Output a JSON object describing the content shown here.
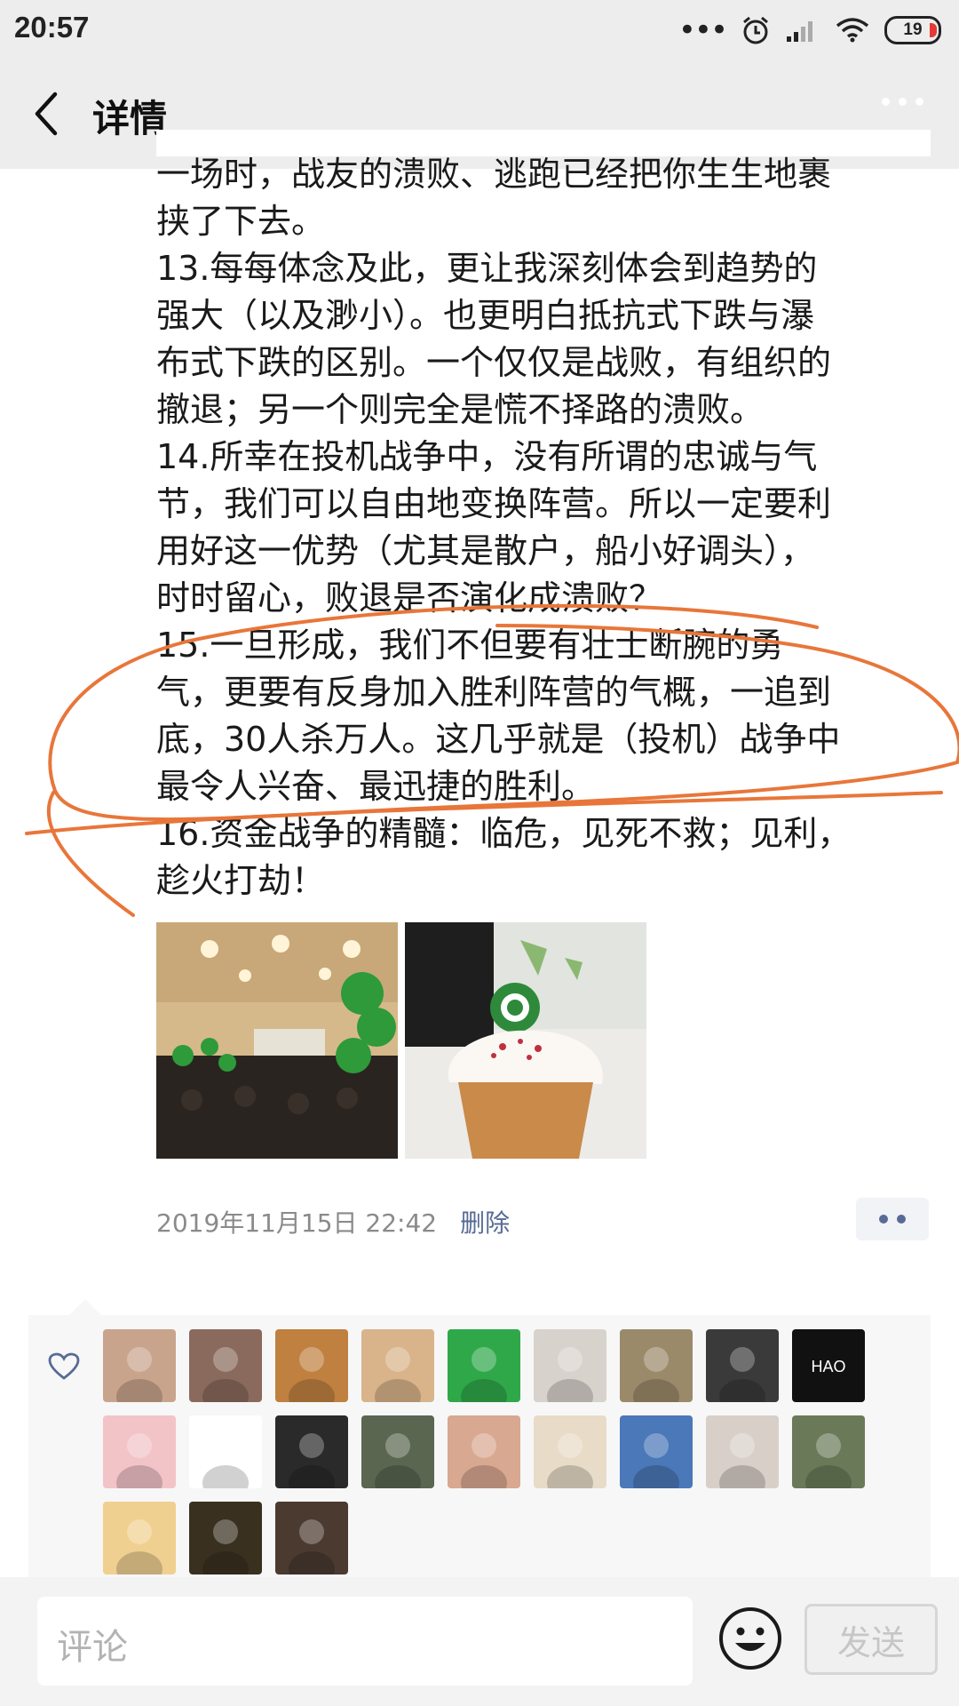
{
  "status_bar": {
    "time": "20:57",
    "battery": "19"
  },
  "nav": {
    "title": "详情"
  },
  "post": {
    "lines": [
      "一场时，战友的溃败、逃跑已经把你生生地裹",
      "挟了下去。",
      "13.每每体念及此，更让我深刻体会到趋势的",
      "强大（以及渺小）。也更明白抵抗式下跌与瀑",
      "布式下跌的区别。一个仅仅是战败，有组织的",
      "撤退；另一个则完全是慌不择路的溃败。",
      "14.所幸在投机战争中，没有所谓的忠诚与气",
      "节，我们可以自由地变换阵营。所以一定要利",
      "用好这一优势（尤其是散户，船小好调头），",
      "时时留心，败退是否演化成溃败？",
      "15.一旦形成，我们不但要有壮士断腕的勇",
      "气，更要有反身加入胜利阵营的气概，一追到",
      "底，30人杀万人。这几乎就是（投机）战争中",
      "最令人兴奋、最迅捷的胜利。",
      "16.资金战争的精髓：临危，见死不救；见利，",
      "趁火打劫！"
    ],
    "timestamp": "2019年11月15日 22:42",
    "delete_label": "删除"
  },
  "photos": [
    {
      "name": "conference-hall-photo"
    },
    {
      "name": "cupcake-photo"
    }
  ],
  "likes": {
    "avatars": [
      {
        "name": "avatar-1",
        "bg": "#c9a48c"
      },
      {
        "name": "avatar-2",
        "bg": "#8a6a5c"
      },
      {
        "name": "avatar-3",
        "bg": "#c08040"
      },
      {
        "name": "avatar-4",
        "bg": "#d9b48a"
      },
      {
        "name": "avatar-5",
        "bg": "#2fa84a"
      },
      {
        "name": "avatar-6",
        "bg": "#d8d2cc"
      },
      {
        "name": "avatar-7",
        "bg": "#9a8a6a"
      },
      {
        "name": "avatar-8",
        "bg": "#3a3a3a"
      },
      {
        "name": "avatar-9",
        "bg": "#111111",
        "text": "HAO"
      },
      {
        "name": "avatar-10",
        "bg": "#f2c4c8"
      },
      {
        "name": "avatar-11",
        "bg": "#ffffff"
      },
      {
        "name": "avatar-12",
        "bg": "#2a2a2a"
      },
      {
        "name": "avatar-13",
        "bg": "#5a6650"
      },
      {
        "name": "avatar-14",
        "bg": "#d8a890"
      },
      {
        "name": "avatar-15",
        "bg": "#e8dcc8"
      },
      {
        "name": "avatar-16",
        "bg": "#4a78b8"
      },
      {
        "name": "avatar-17",
        "bg": "#d8d0c8"
      },
      {
        "name": "avatar-18",
        "bg": "#6a7a58"
      },
      {
        "name": "avatar-19",
        "bg": "#f0d090"
      },
      {
        "name": "avatar-20",
        "bg": "#3a3020"
      },
      {
        "name": "avatar-21",
        "bg": "#4a3a30"
      }
    ]
  },
  "bottom": {
    "comment_placeholder": "评论",
    "send_label": "发送"
  },
  "colors": {
    "link": "#576b95",
    "annotation": "#e8763a",
    "bar_bg": "#ededed"
  }
}
